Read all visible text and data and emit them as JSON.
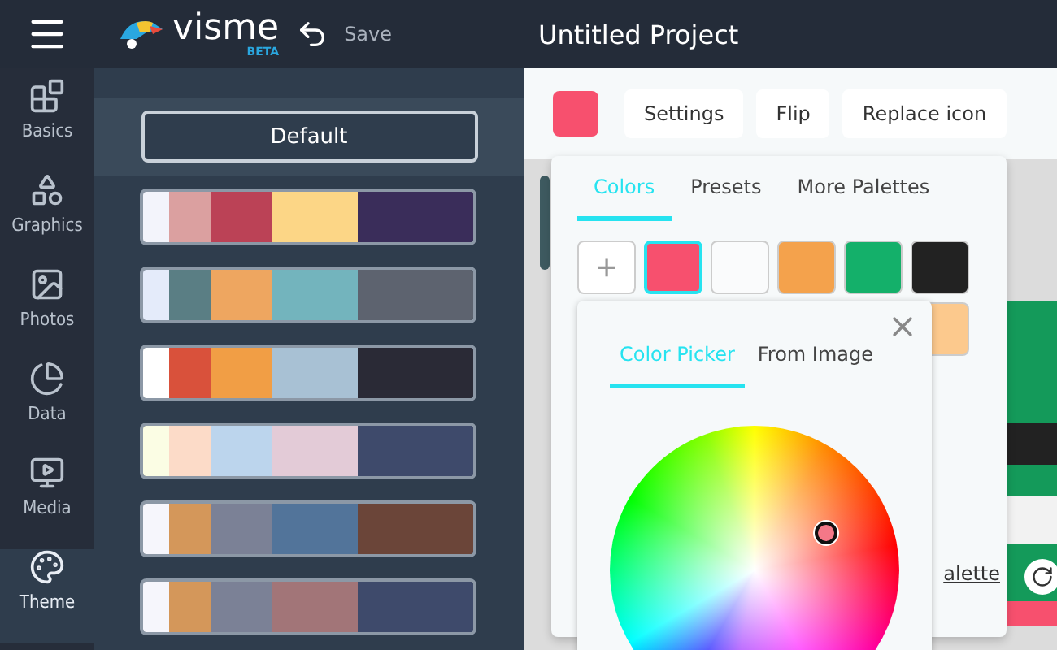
{
  "topbar": {
    "logo": "visme",
    "logo_badge": "BETA",
    "save": "Save",
    "title": "Untitled Project"
  },
  "rail": [
    {
      "label": "Basics",
      "selected": false
    },
    {
      "label": "Graphics",
      "selected": false
    },
    {
      "label": "Photos",
      "selected": false
    },
    {
      "label": "Data",
      "selected": false
    },
    {
      "label": "Media",
      "selected": false
    },
    {
      "label": "Theme",
      "selected": true
    }
  ],
  "theme_panel": {
    "default_button": "Default",
    "palettes": [
      {
        "swatches": [
          {
            "color": "#f3f4fb"
          },
          {
            "color": "#dba0a0"
          },
          {
            "color": "#bb4256"
          },
          {
            "color": "#fcd686"
          },
          {
            "color": "#3a2d5a"
          }
        ]
      },
      {
        "swatches": [
          {
            "color": "#e4ebfa"
          },
          {
            "color": "#5a7e84"
          },
          {
            "color": "#eea660"
          },
          {
            "color": "#73b4bd"
          },
          {
            "color": "#5d636f"
          }
        ]
      },
      {
        "swatches": [
          {
            "color": "#ffffff"
          },
          {
            "color": "#d9513b"
          },
          {
            "color": "#f19e45"
          },
          {
            "color": "#a8c1d4"
          },
          {
            "color": "#2a2a36"
          }
        ]
      },
      {
        "swatches": [
          {
            "color": "#fbfde4"
          },
          {
            "color": "#fcdbc8"
          },
          {
            "color": "#bcd5ed"
          },
          {
            "color": "#e3cbd7"
          },
          {
            "color": "#3e4a6b"
          }
        ]
      },
      {
        "swatches": [
          {
            "color": "#f6f6fc"
          },
          {
            "color": "#d4975a"
          },
          {
            "color": "#7b8196"
          },
          {
            "color": "#52749a"
          },
          {
            "color": "#6b4539"
          }
        ]
      },
      {
        "swatches": [
          {
            "color": "#f6f6fc"
          },
          {
            "color": "#d4975a"
          },
          {
            "color": "#7b8196"
          },
          {
            "color": "#a27578"
          },
          {
            "color": "#3e4a6b"
          }
        ]
      }
    ]
  },
  "toolbar": {
    "buttons": [
      "Settings",
      "Flip",
      "Replace icon"
    ]
  },
  "color_popover": {
    "tabs": [
      {
        "label": "Colors",
        "selected": true
      },
      {
        "label": "Presets",
        "selected": false
      },
      {
        "label": "More Palettes",
        "selected": false
      }
    ],
    "swatches": [
      {
        "kind": "add",
        "label": "+",
        "selected": false
      },
      {
        "kind": "color",
        "color": "#f7506e",
        "selected": true
      },
      {
        "kind": "color",
        "color": "#fafbfc",
        "selected": false
      },
      {
        "kind": "color",
        "color": "#f4a24c",
        "selected": false
      },
      {
        "kind": "color",
        "color": "#14b06a",
        "selected": false
      },
      {
        "kind": "color",
        "color": "#222222",
        "selected": false
      },
      {
        "kind": "color",
        "color": "#fcc98d",
        "selected": false
      }
    ],
    "link": "alette"
  },
  "picker": {
    "tabs": [
      {
        "label": "Color Picker",
        "selected": true
      },
      {
        "label": "From Image",
        "selected": false
      }
    ]
  }
}
